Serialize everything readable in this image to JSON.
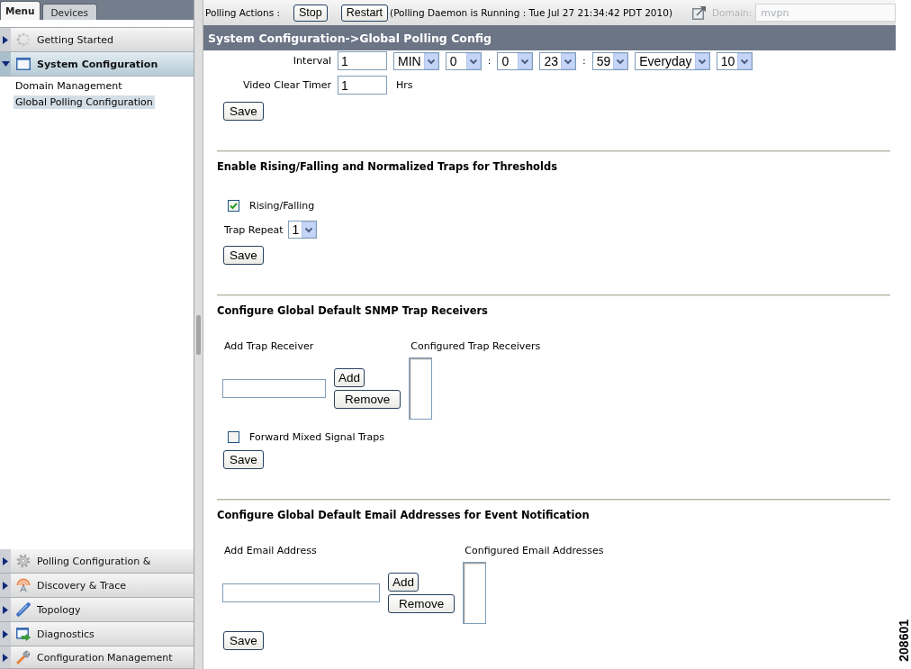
{
  "sidebar": {
    "tabs": [
      {
        "label": "Menu",
        "selected": true
      },
      {
        "label": "Devices",
        "selected": false
      }
    ],
    "items": [
      {
        "label": "Getting Started",
        "expanded": false
      },
      {
        "label": "System Configuration",
        "expanded": true,
        "children": [
          {
            "label": "Domain Management",
            "selected": false
          },
          {
            "label": "Global Polling Configuration",
            "selected": true
          }
        ]
      }
    ],
    "bottom_items": [
      {
        "label": "Polling Configuration &",
        "expanded": false
      },
      {
        "label": "Discovery & Trace",
        "expanded": false
      },
      {
        "label": "Topology",
        "expanded": false
      },
      {
        "label": "Diagnostics",
        "expanded": false
      },
      {
        "label": "Configuration Management",
        "expanded": false
      }
    ]
  },
  "top_bar": {
    "label": "Polling Actions :",
    "buttons": [
      "Stop",
      "Restart"
    ],
    "status": "(Polling Daemon is Running : Tue Jul 27 21:34:42 PDT 2010)",
    "domain": {
      "label": "Domain:",
      "value": "mvpn",
      "disabled": true
    }
  },
  "header": {
    "title": "System Configuration->Global Polling Config"
  },
  "sections": [
    {
      "kind": "timers",
      "rows": [
        {
          "label": "Interval",
          "controls": [
            {
              "kind": "input",
              "value": "1"
            },
            {
              "kind": "select",
              "value": "MIN"
            },
            {
              "kind": "select",
              "value": "0"
            },
            {
              "kind": "separator",
              "text": ":"
            },
            {
              "kind": "select",
              "value": "0"
            },
            {
              "kind": "select",
              "value": "23"
            },
            {
              "kind": "separator",
              "text": ":"
            },
            {
              "kind": "select",
              "value": "59"
            },
            {
              "kind": "select",
              "value": "Everyday"
            },
            {
              "kind": "select",
              "value": "10"
            }
          ]
        },
        {
          "label": "Video Clear Timer",
          "controls": [
            {
              "kind": "input",
              "value": "1"
            },
            {
              "kind": "unit",
              "text": "Hrs"
            }
          ]
        }
      ],
      "save": "Save"
    },
    {
      "kind": "thresholds",
      "title": "Enable Rising/Falling and Normalized Traps for Thresholds",
      "checkbox": {
        "label": "Rising/Falling",
        "checked": true
      },
      "repeat": {
        "label": "Trap Repeat",
        "value": "1"
      },
      "save": "Save"
    },
    {
      "kind": "receivers",
      "title": "Configure Global Default SNMP Trap Receivers",
      "add_label": "Add Trap Receiver",
      "list_label": "Configured Trap Receivers",
      "buttons": [
        "Add",
        "Remove"
      ],
      "checkbox": {
        "label": "Forward Mixed Signal Traps",
        "checked": false
      },
      "save": "Save"
    },
    {
      "kind": "receivers",
      "title": "Configure Global Default Email Addresses for Event Notification",
      "add_label": "Add Email Address",
      "list_label": "Configured Email Addresses",
      "buttons": [
        "Add",
        "Remove"
      ],
      "save": "Save"
    }
  ],
  "figure_number": "208601"
}
